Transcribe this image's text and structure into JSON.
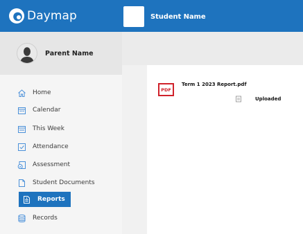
{
  "app": {
    "brand": "Daymap",
    "student_name": "Student Name"
  },
  "sidebar": {
    "parent_name": "Parent Name",
    "items": [
      {
        "label": "Home",
        "icon": "home-icon"
      },
      {
        "label": "Calendar",
        "icon": "calendar-icon"
      },
      {
        "label": "This Week",
        "icon": "this-week-icon"
      },
      {
        "label": "Attendance",
        "icon": "attendance-icon"
      },
      {
        "label": "Assessment",
        "icon": "assessment-icon"
      },
      {
        "label": "Student Documents",
        "icon": "document-icon"
      },
      {
        "label": "Reports",
        "icon": "report-icon",
        "active": true
      },
      {
        "label": "Records",
        "icon": "records-icon"
      }
    ]
  },
  "main": {
    "file": {
      "type_badge": "PDF",
      "name": "Term 1 2023 Report.pdf",
      "status": "Uploaded"
    }
  },
  "colors": {
    "primary": "#1e73be",
    "pdf_red": "#d0212a",
    "icon_blue": "#4a90d9"
  }
}
